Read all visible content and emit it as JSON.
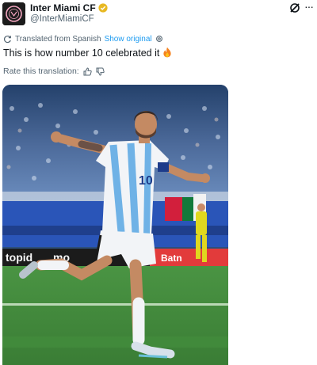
{
  "account": {
    "name": "Inter Miami CF",
    "handle": "@InterMiamiCF",
    "avatar_icon": "inter-miami-crest-icon",
    "verified_color": "#e8b923"
  },
  "translation": {
    "note": "Translated from Spanish",
    "show_original": "Show original"
  },
  "tweet": {
    "text": "This is how number 10 celebrated it",
    "emoji_icon": "fire-icon"
  },
  "rating": {
    "label": "Rate this translation:"
  },
  "media": {
    "board_text_left": "topid",
    "board_text_mid": "mo",
    "board_text_right": "Batn",
    "jersey_number": "10"
  },
  "colors": {
    "link": "#1d9bf0",
    "secondary_text": "#536471",
    "pitch": "#3f8a3a"
  }
}
